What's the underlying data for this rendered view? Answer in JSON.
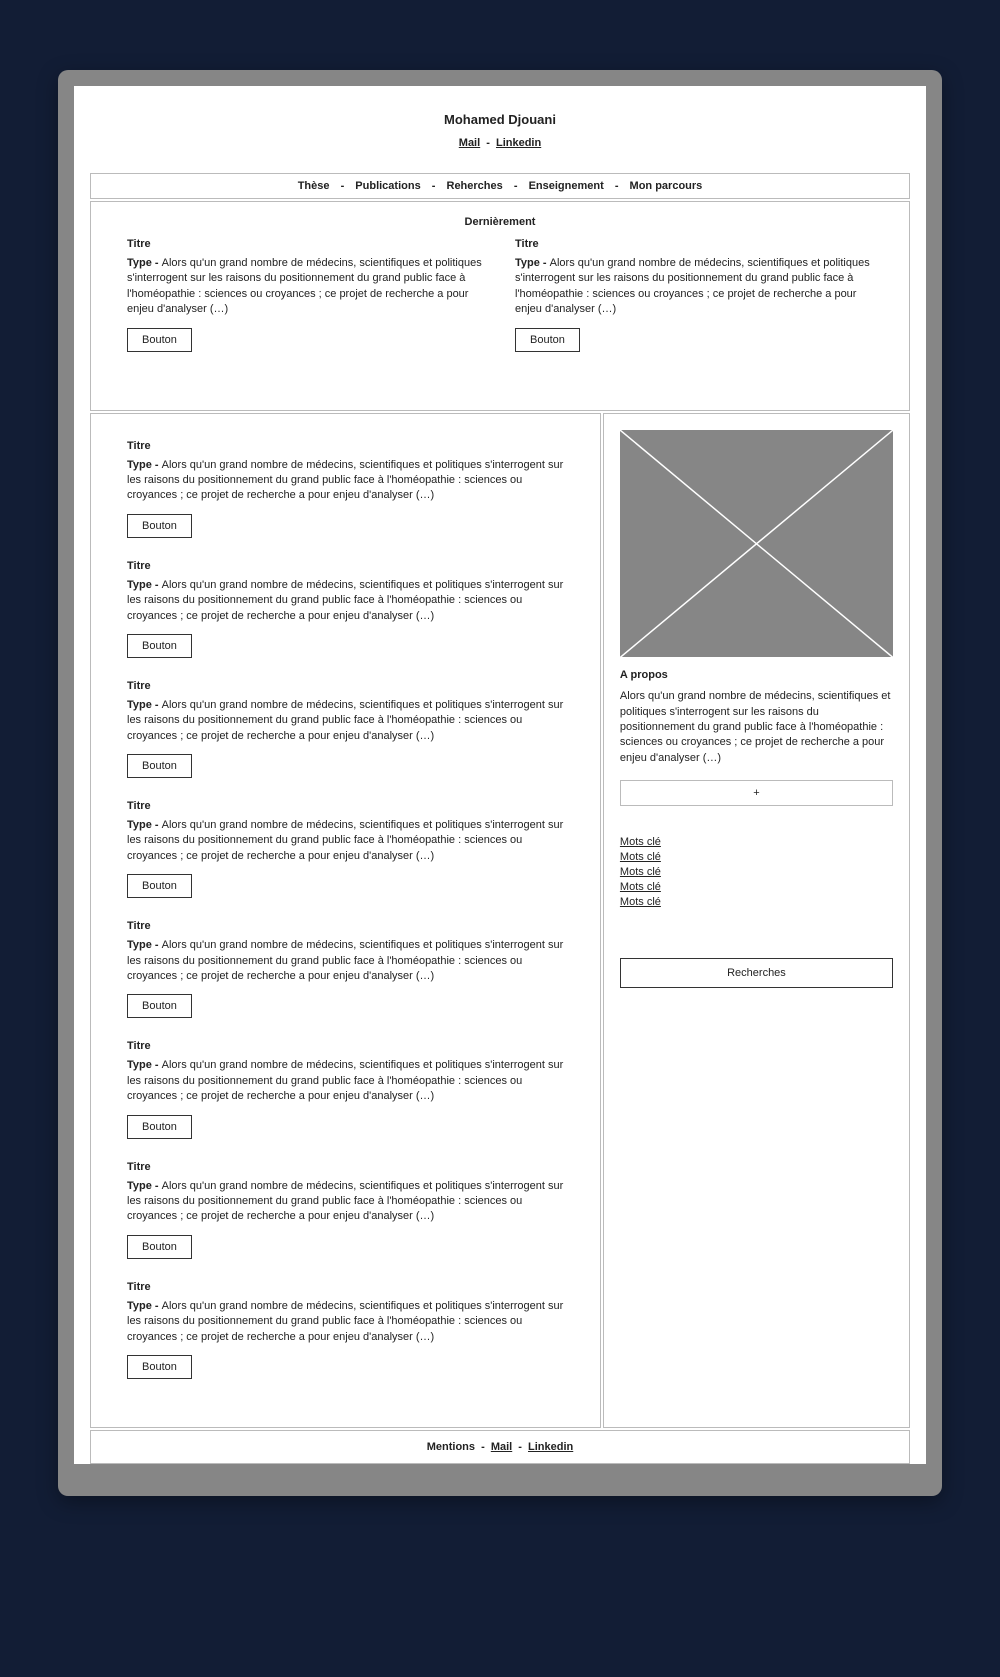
{
  "header": {
    "name": "Mohamed Djouani",
    "mail": "Mail",
    "linkedin": "Linkedin",
    "sep": "-"
  },
  "nav": {
    "items": [
      "Thèse",
      "Publications",
      "Reherches",
      "Enseignement",
      "Mon parcours"
    ],
    "sep": "-"
  },
  "recent": {
    "title": "Dernièrement",
    "items": [
      {
        "title": "Titre",
        "type_label": "Type - ",
        "desc": "Alors qu'un grand nombre de médecins, scientifiques et politiques s'interrogent sur les raisons du positionnement du grand public face à l'homéopathie : sciences ou croyances ; ce projet de recherche a pour enjeu d'analyser (…)",
        "button": "Bouton"
      },
      {
        "title": "Titre",
        "type_label": "Type - ",
        "desc": "Alors qu'un grand nombre de médecins, scientifiques et politiques s'interrogent sur les raisons du positionnement du grand public face à l'homéopathie : sciences ou croyances ; ce projet de recherche a pour enjeu d'analyser (…)",
        "button": "Bouton"
      }
    ]
  },
  "list": {
    "items": [
      {
        "title": "Titre",
        "type_label": "Type - ",
        "desc": "Alors qu'un grand nombre de médecins, scientifiques et politiques s'interrogent sur les raisons du positionnement du grand public face à l'homéopathie : sciences ou croyances ; ce projet de recherche a pour enjeu d'analyser (…)",
        "button": "Bouton"
      },
      {
        "title": "Titre",
        "type_label": "Type - ",
        "desc": "Alors qu'un grand nombre de médecins, scientifiques et politiques s'interrogent sur les raisons du positionnement du grand public face à l'homéopathie : sciences ou croyances ; ce projet de recherche a pour enjeu d'analyser (…)",
        "button": "Bouton"
      },
      {
        "title": "Titre",
        "type_label": "Type - ",
        "desc": "Alors qu'un grand nombre de médecins, scientifiques et politiques s'interrogent sur les raisons du positionnement du grand public face à l'homéopathie : sciences ou croyances ; ce projet de recherche a pour enjeu d'analyser (…)",
        "button": "Bouton"
      },
      {
        "title": "Titre",
        "type_label": "Type - ",
        "desc": "Alors qu'un grand nombre de médecins, scientifiques et politiques s'interrogent sur les raisons du positionnement du grand public face à l'homéopathie : sciences ou croyances ; ce projet de recherche a pour enjeu d'analyser (…)",
        "button": "Bouton"
      },
      {
        "title": "Titre",
        "type_label": "Type - ",
        "desc": "Alors qu'un grand nombre de médecins, scientifiques et politiques s'interrogent sur les raisons du positionnement du grand public face à l'homéopathie : sciences ou croyances ; ce projet de recherche a pour enjeu d'analyser (…)",
        "button": "Bouton"
      },
      {
        "title": "Titre",
        "type_label": "Type - ",
        "desc": "Alors qu'un grand nombre de médecins, scientifiques et politiques s'interrogent sur les raisons du positionnement du grand public face à l'homéopathie : sciences ou croyances ; ce projet de recherche a pour enjeu d'analyser (…)",
        "button": "Bouton"
      },
      {
        "title": "Titre",
        "type_label": "Type - ",
        "desc": "Alors qu'un grand nombre de médecins, scientifiques et politiques s'interrogent sur les raisons du positionnement du grand public face à l'homéopathie : sciences ou croyances ; ce projet de recherche a pour enjeu d'analyser (…)",
        "button": "Bouton"
      },
      {
        "title": "Titre",
        "type_label": "Type - ",
        "desc": "Alors qu'un grand nombre de médecins, scientifiques et politiques s'interrogent sur les raisons du positionnement du grand public face à l'homéopathie : sciences ou croyances ; ce projet de recherche a pour enjeu d'analyser (…)",
        "button": "Bouton"
      }
    ]
  },
  "sidebar": {
    "about_title": "A propos",
    "about_text": "Alors qu'un grand nombre de médecins, scientifiques et politiques s'interrogent sur les raisons du positionnement du grand public face à l'homéopathie : sciences ou croyances ; ce projet de recherche a pour enjeu d'analyser (…)",
    "plus": "+",
    "keywords": [
      "Mots clé",
      "Mots clé",
      "Mots clé",
      "Mots clé",
      "Mots clé"
    ],
    "big_button": "Recherches"
  },
  "footer": {
    "mentions": "Mentions",
    "mail": "Mail",
    "linkedin": "Linkedin",
    "sep": "-"
  }
}
